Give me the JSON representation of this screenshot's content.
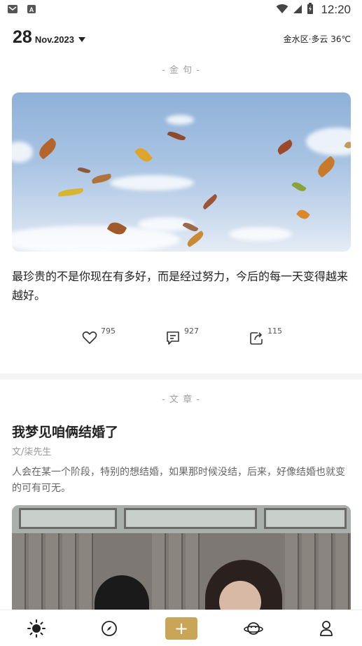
{
  "status_bar": {
    "time": "12:20",
    "left_icons": [
      "mail-icon",
      "font-icon"
    ],
    "right_icons": [
      "wifi-icon",
      "cell-signal-icon",
      "battery-icon"
    ]
  },
  "header": {
    "day": "28",
    "month_year": "Nov.2023",
    "weather": "金水区·多云 36℃"
  },
  "quote_section": {
    "label": "- 金 句 -",
    "text": "最珍贵的不是你现在有多好，而是经过努力，今后的每一天变得越来越好。",
    "likes": "795",
    "comments": "927",
    "shares": "115"
  },
  "article_section": {
    "label": "- 文 章 -",
    "title": "我梦见咱俩结婚了",
    "author": "文/柒先生",
    "summary": "人会在某一个阶段，特别的想结婚，如果那时候没结，后来，好像结婚也就变的可有可无。"
  },
  "bottom_nav": {
    "items": [
      "sun-icon",
      "compass-icon",
      "add-icon",
      "planet-icon",
      "person-icon"
    ],
    "add_label": "+"
  },
  "colors": {
    "accent": "#c9a557",
    "muted": "#a0a0a0"
  }
}
